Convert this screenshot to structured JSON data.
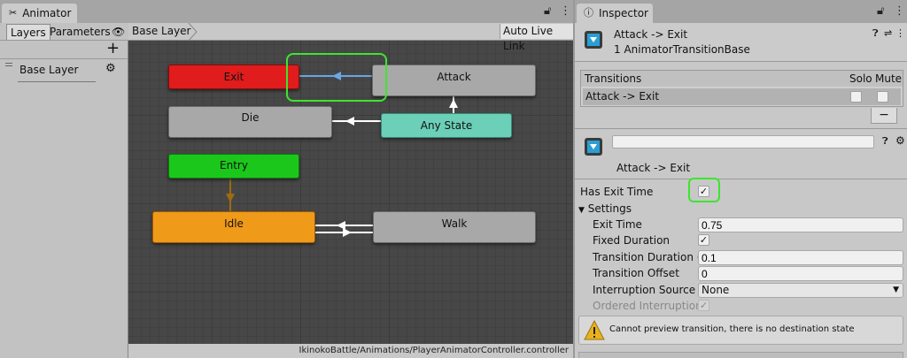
{
  "animator": {
    "tab_title": "Animator",
    "subtabs": {
      "layers": "Layers",
      "parameters": "Parameters"
    },
    "layer_name": "Base Layer",
    "breadcrumb": "Base Layer",
    "auto_live_link": "Auto Live Link",
    "status_path": "IkinokoBattle/Animations/PlayerAnimatorController.controller",
    "states": {
      "exit": "Exit",
      "attack": "Attack",
      "die": "Die",
      "any_state": "Any State",
      "entry": "Entry",
      "idle": "Idle",
      "walk": "Walk"
    }
  },
  "inspector": {
    "tab_title": "Inspector",
    "header_title": "Attack -> Exit",
    "header_subtitle": "1 AnimatorTransitionBase",
    "transitions_label": "Transitions",
    "solo_label": "Solo",
    "mute_label": "Mute",
    "transition_item": "Attack -> Exit",
    "minus_label": "−",
    "name_field_value": "",
    "transition_caption": "Attack -> Exit",
    "has_exit_time_label": "Has Exit Time",
    "settings_label": "Settings",
    "exit_time_label": "Exit Time",
    "exit_time_value": "0.75",
    "fixed_duration_label": "Fixed Duration",
    "transition_duration_label": "Transition Duration (s)",
    "transition_duration_value": "0.1",
    "transition_offset_label": "Transition Offset",
    "transition_offset_value": "0",
    "interruption_source_label": "Interruption Source",
    "interruption_source_value": "None",
    "ordered_interruption_label": "Ordered Interruption",
    "warning_text": "Cannot preview transition, there is no destination state",
    "checkmark": "✓"
  },
  "colors": {
    "exit_state": "#e01c1c",
    "entry_state": "#1cc71c",
    "any_state": "#6ccfb8",
    "idle_state": "#f09a1a",
    "grey_state": "#9e9e9e",
    "highlight": "#3de52f",
    "selected_transition": "#6aa6e6"
  }
}
